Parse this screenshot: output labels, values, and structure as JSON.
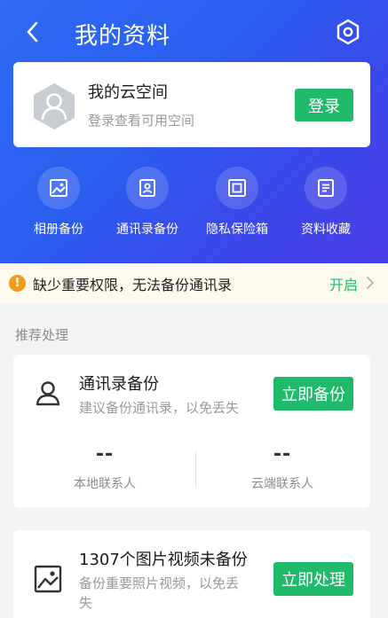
{
  "header": {
    "title": "我的资料",
    "back_icon": "chevron-left-icon",
    "settings_icon": "hexagon-settings-icon"
  },
  "cloud": {
    "title": "我的云空间",
    "subtitle": "登录查看可用空间",
    "login_label": "登录",
    "avatar_icon": "user-hexagon-icon"
  },
  "quick_actions": [
    {
      "label": "相册备份",
      "icon": "photo-icon"
    },
    {
      "label": "通讯录备份",
      "icon": "contact-card-icon"
    },
    {
      "label": "隐私保险箱",
      "icon": "safe-icon"
    },
    {
      "label": "资料收藏",
      "icon": "document-icon"
    }
  ],
  "alert": {
    "text": "缺少重要权限，无法备份通讯录",
    "action": "开启",
    "icon_glyph": "!"
  },
  "recommend": {
    "section_title": "推荐处理",
    "contacts": {
      "title": "通讯录备份",
      "subtitle": "建议备份通讯录，以免丢失",
      "button": "立即备份",
      "local_value": "--",
      "local_label": "本地联系人",
      "cloud_value": "--",
      "cloud_label": "云端联系人"
    },
    "photos": {
      "title": "1307个图片视频未备份",
      "subtitle_line1": "备份重要照片视频，以免丢",
      "subtitle_line2": "失",
      "button": "立即处理"
    }
  },
  "colors": {
    "header_gradient_start": "#2f6bf3",
    "header_gradient_end": "#4a3fe6",
    "accent_green": "#1fba6a",
    "alert_orange": "#f29b1b",
    "alert_bg": "#fdf9ec"
  }
}
